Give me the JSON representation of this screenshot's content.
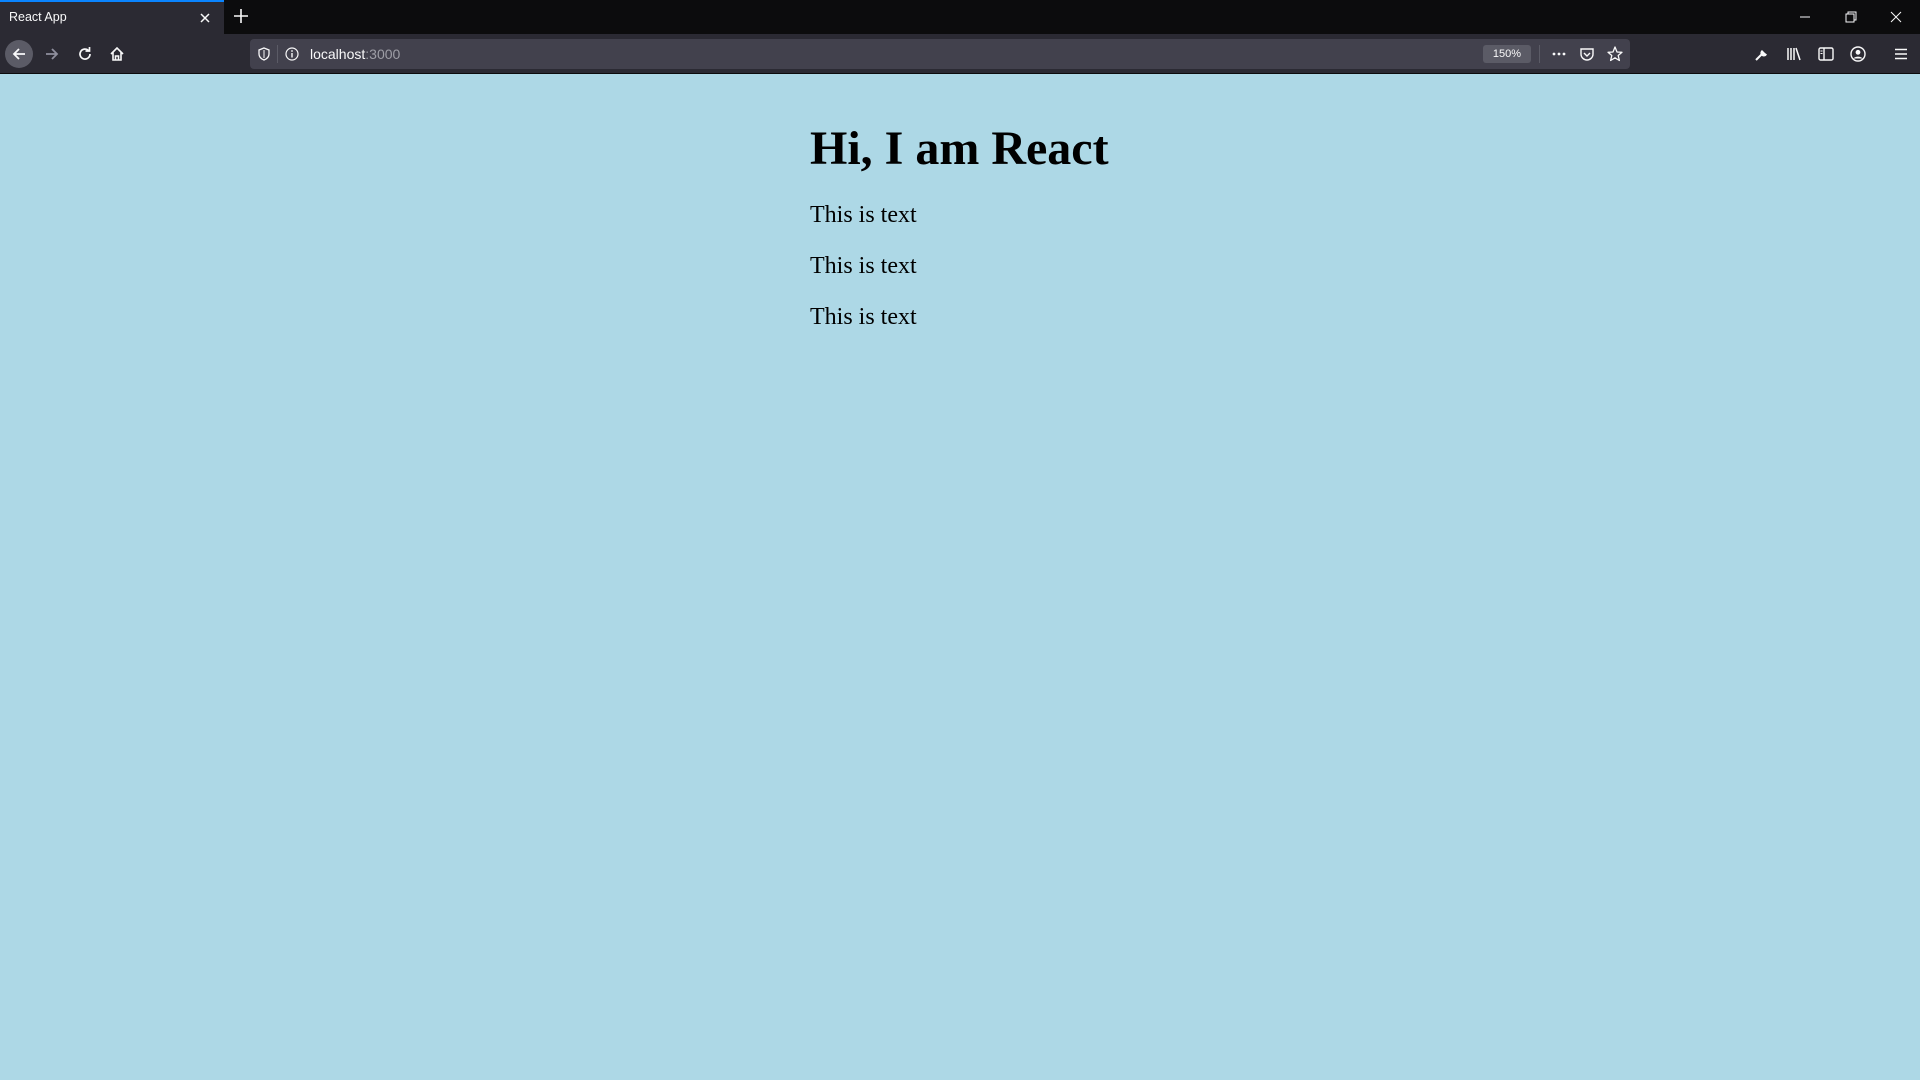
{
  "browser": {
    "tab": {
      "title": "React App"
    },
    "url": {
      "host": "localhost",
      "port": ":3000"
    },
    "zoom": "150%"
  },
  "icons": {
    "tab_close": "close-icon",
    "new_tab": "plus-icon",
    "back": "arrow-left-icon",
    "forward": "arrow-right-icon",
    "reload": "reload-icon",
    "home": "home-icon",
    "shield": "shield-icon",
    "info": "info-icon",
    "more": "ellipsis-icon",
    "pocket": "pocket-icon",
    "bookmark": "star-icon",
    "tools": "wrench-icon",
    "library": "library-icon",
    "sidebar": "sidebar-icon",
    "account": "account-icon",
    "menu": "hamburger-menu-icon"
  },
  "colors": {
    "page_background": "#add8e6",
    "tab_accent": "#0a84ff",
    "chrome_dark": "#0c0c0d",
    "chrome_toolbar": "#2b2a33"
  },
  "page": {
    "heading": "Hi, I am React",
    "paragraphs": [
      "This is text",
      "This is text",
      "This is text"
    ]
  }
}
